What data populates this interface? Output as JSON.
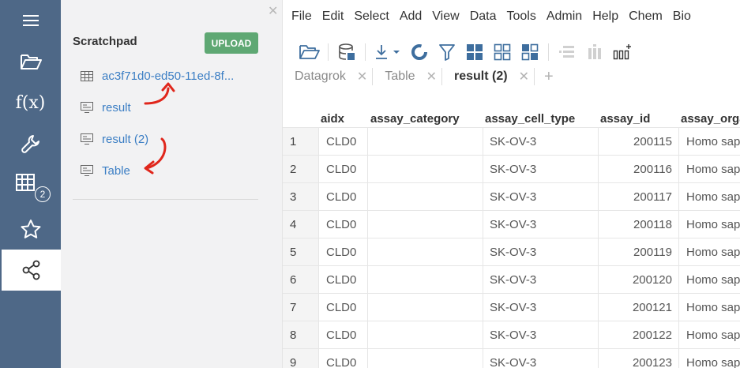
{
  "rail": {
    "items": [
      {
        "icon": "hamburger-menu-icon"
      },
      {
        "icon": "folder-open-icon"
      },
      {
        "icon": "function-icon",
        "label": "f(x)"
      },
      {
        "icon": "wrench-icon"
      },
      {
        "icon": "table-grid-icon",
        "badge": "2"
      },
      {
        "icon": "star-icon"
      },
      {
        "icon": "share-icon",
        "active": true
      }
    ]
  },
  "scratchpad": {
    "title": "Scratchpad",
    "upload_label": "UPLOAD",
    "files": [
      {
        "label": "ac3f71d0-ed50-11ed-8f...",
        "icon": "table-icon"
      },
      {
        "label": "result",
        "icon": "view-icon"
      },
      {
        "label": "result (2)",
        "icon": "view-icon"
      },
      {
        "label": "Table",
        "icon": "view-icon"
      }
    ],
    "annotation_color": "#e0261b"
  },
  "menubar": [
    "File",
    "Edit",
    "Select",
    "Add",
    "View",
    "Data",
    "Tools",
    "Admin",
    "Help",
    "Chem",
    "Bio"
  ],
  "tabs": [
    {
      "label": "Datagrok",
      "active": false
    },
    {
      "label": "Table",
      "active": false
    },
    {
      "label": "result (2)",
      "active": true
    }
  ],
  "grid": {
    "columns": [
      "aidx",
      "assay_category",
      "assay_cell_type",
      "assay_id",
      "assay_orga"
    ],
    "rows": [
      {
        "num": "1",
        "aidx": "CLD0",
        "assay_category": "",
        "assay_cell_type": "SK-OV-3",
        "assay_id": "200115",
        "assay_organism": "Homo sap"
      },
      {
        "num": "2",
        "aidx": "CLD0",
        "assay_category": "",
        "assay_cell_type": "SK-OV-3",
        "assay_id": "200116",
        "assay_organism": "Homo sap"
      },
      {
        "num": "3",
        "aidx": "CLD0",
        "assay_category": "",
        "assay_cell_type": "SK-OV-3",
        "assay_id": "200117",
        "assay_organism": "Homo sap"
      },
      {
        "num": "4",
        "aidx": "CLD0",
        "assay_category": "",
        "assay_cell_type": "SK-OV-3",
        "assay_id": "200118",
        "assay_organism": "Homo sap"
      },
      {
        "num": "5",
        "aidx": "CLD0",
        "assay_category": "",
        "assay_cell_type": "SK-OV-3",
        "assay_id": "200119",
        "assay_organism": "Homo sap"
      },
      {
        "num": "6",
        "aidx": "CLD0",
        "assay_category": "",
        "assay_cell_type": "SK-OV-3",
        "assay_id": "200120",
        "assay_organism": "Homo sap"
      },
      {
        "num": "7",
        "aidx": "CLD0",
        "assay_category": "",
        "assay_cell_type": "SK-OV-3",
        "assay_id": "200121",
        "assay_organism": "Homo sap"
      },
      {
        "num": "8",
        "aidx": "CLD0",
        "assay_category": "",
        "assay_cell_type": "SK-OV-3",
        "assay_id": "200122",
        "assay_organism": "Homo sap"
      },
      {
        "num": "9",
        "aidx": "CLD0",
        "assay_category": "",
        "assay_cell_type": "SK-OV-3",
        "assay_id": "200123",
        "assay_organism": "Homo sap"
      }
    ]
  },
  "colors": {
    "rail_bg": "#4e6887",
    "panel_bg": "#f2f2f3",
    "upload_bg": "#5fa873",
    "link": "#3b7ec4"
  }
}
